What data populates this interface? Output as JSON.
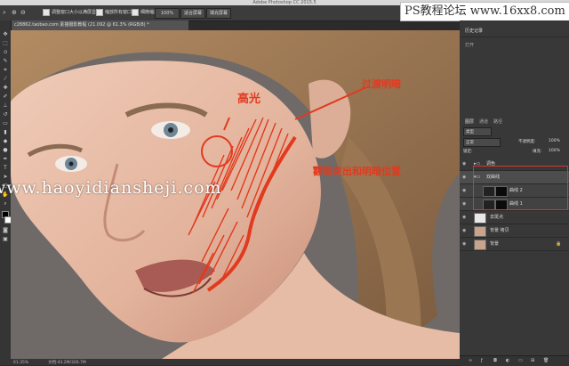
{
  "window": {
    "title": "Adobe Photoshop CC 2015.5"
  },
  "options_bar": {
    "opt1_label": "调整窗口大小以满屏显示",
    "opt2_label": "缩放所有窗口",
    "opt3_label": "细微缩放",
    "zoom_value": "100%",
    "fit_screen_label": "适合屏幕",
    "fill_screen_label": "填充屏幕"
  },
  "document": {
    "tab_label": "c28862.taobao.com 素描摄影教程 (21.092 @ 61.3% (RGB/8) *"
  },
  "watermark": {
    "site_badge": "PS教程论坛 www.16xx8.com",
    "overlay_text": "www.haoyidiansheji.com"
  },
  "annotations": {
    "highlight": "高光",
    "shadow_note": "过渡明暗",
    "contour_note": "颧骨突出和明暗位置"
  },
  "status": {
    "zoom": "61.35%",
    "doc_info": "文档:43.2M/326.7M"
  },
  "history_panel": {
    "tab1": "历史记录",
    "tab2": "历史记录",
    "item": "打开"
  },
  "layers_panel": {
    "tabs": [
      "图层",
      "通道",
      "路径"
    ],
    "kind_label": "类型",
    "blend_mode": "正常",
    "opacity_label": "不透明度:",
    "opacity_value": "100%",
    "lock_label": "锁定:",
    "fill_label": "填充:",
    "fill_value": "100%",
    "layers": [
      {
        "name": "调色",
        "type": "group"
      },
      {
        "name": "双曲线",
        "type": "group"
      },
      {
        "name": "曲线 2",
        "type": "adjust"
      },
      {
        "name": "曲线 1",
        "type": "adjust"
      },
      {
        "name": "去斑点",
        "type": "pixel"
      },
      {
        "name": "背景 拷贝",
        "type": "pixel"
      },
      {
        "name": "背景",
        "type": "pixel"
      }
    ]
  },
  "colors": {
    "accent_red": "#e23a1f",
    "panel_bg": "#383838",
    "canvas_bg": "#737070"
  }
}
